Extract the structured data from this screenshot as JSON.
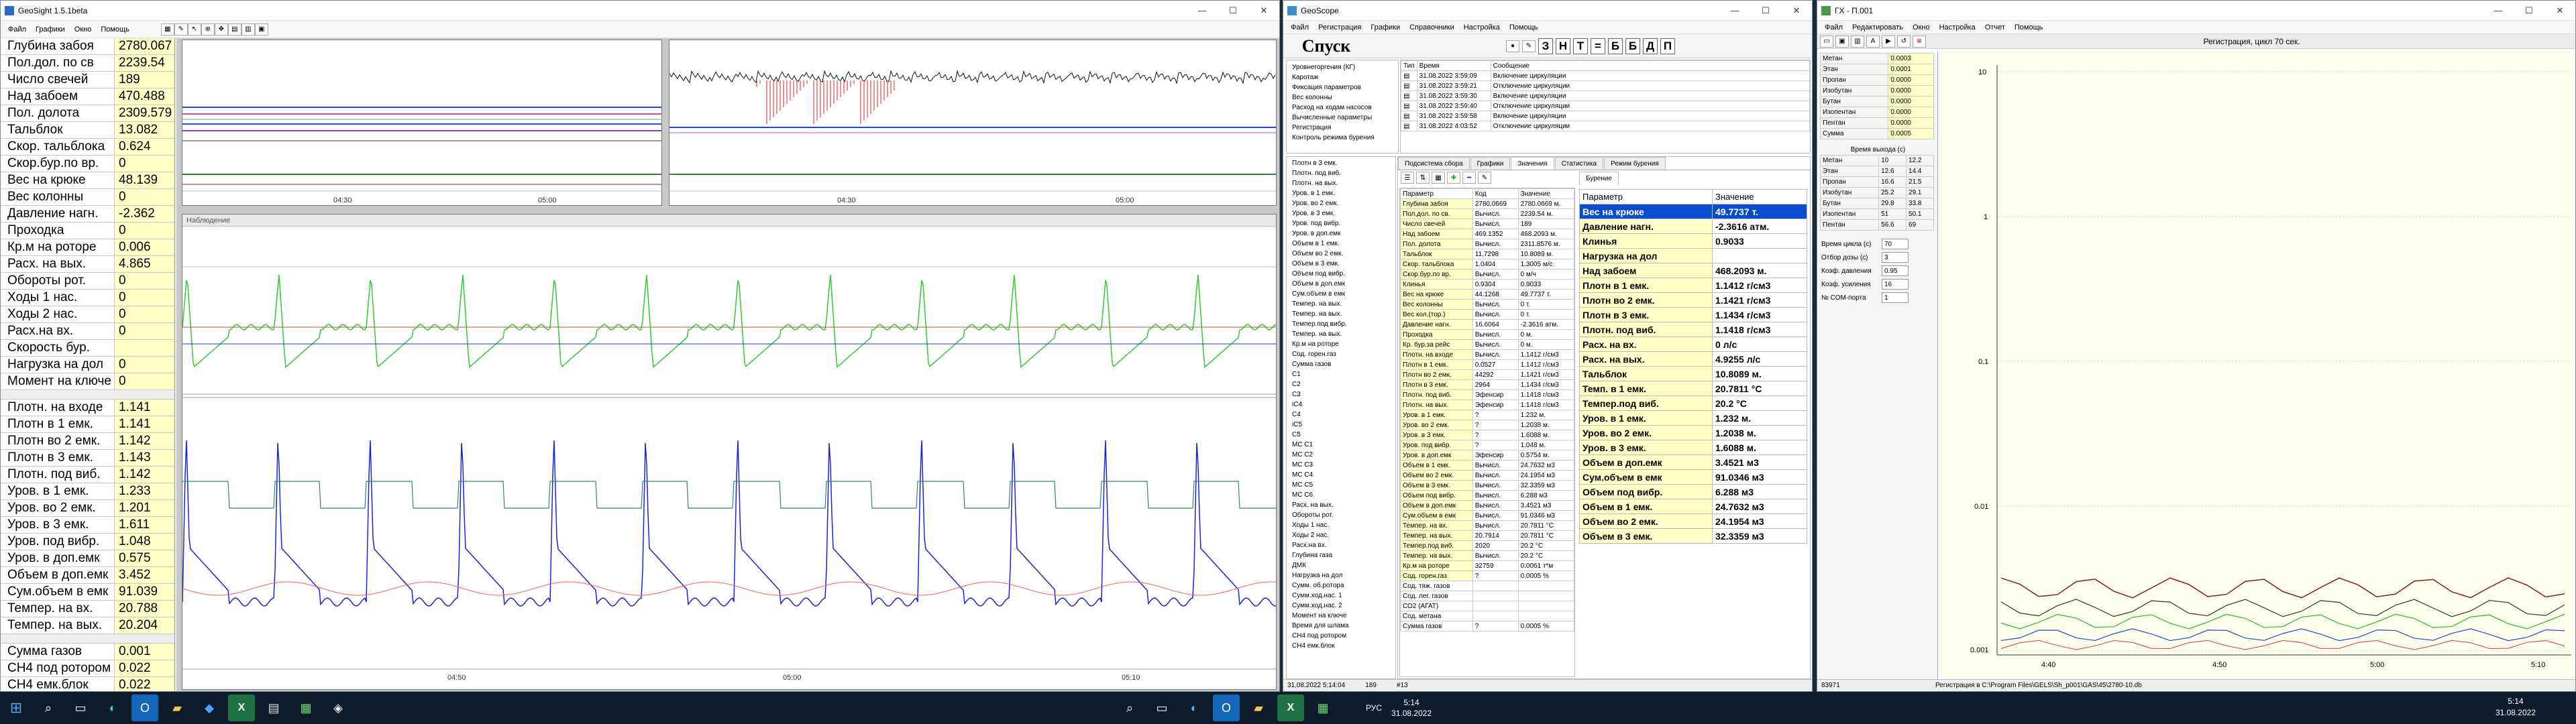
{
  "w1": {
    "title": "GeoSight 1.5.1beta",
    "menu": [
      "Файл",
      "Графики",
      "Окно",
      "Помощь"
    ],
    "params1": [
      {
        "n": "Глубина забоя",
        "v": "2780.067"
      },
      {
        "n": "Пол.дол. по св",
        "v": "2239.54"
      },
      {
        "n": "Число свечей",
        "v": "189"
      },
      {
        "n": "Над забоем",
        "v": "470.488"
      },
      {
        "n": "Пол. долота",
        "v": "2309.579"
      },
      {
        "n": "Тальблок",
        "v": "13.082"
      },
      {
        "n": "Скор. тальблока",
        "v": "0.624"
      },
      {
        "n": "Скор.бур.по вр.",
        "v": "0"
      },
      {
        "n": "Вес на крюке",
        "v": "48.139"
      },
      {
        "n": "Вес колонны",
        "v": "0"
      },
      {
        "n": "Давление нагн.",
        "v": "-2.362"
      },
      {
        "n": "Проходка",
        "v": "0"
      },
      {
        "n": "Кр.м на роторе",
        "v": "0.006"
      },
      {
        "n": "Расх. на вых.",
        "v": "4.865"
      },
      {
        "n": "Обороты рот.",
        "v": "0"
      },
      {
        "n": "Ходы 1 нас.",
        "v": "0"
      },
      {
        "n": "Ходы 2 нас.",
        "v": "0"
      },
      {
        "n": "Расх.на вх.",
        "v": "0"
      },
      {
        "n": "Скорость бур.",
        "v": ""
      },
      {
        "n": "Нагрузка на дол",
        "v": "0"
      },
      {
        "n": "Момент на ключе",
        "v": "0"
      }
    ],
    "params2": [
      {
        "n": "Плотн. на входе",
        "v": "1.141"
      },
      {
        "n": "Плотн в 1 емк.",
        "v": "1.141"
      },
      {
        "n": "Плотн во 2 емк.",
        "v": "1.142"
      },
      {
        "n": "Плотн в 3 емк.",
        "v": "1.143"
      },
      {
        "n": "Плотн. под виб.",
        "v": "1.142"
      },
      {
        "n": "Уров. в 1 емк.",
        "v": "1.233"
      },
      {
        "n": "Уров. во 2 емк.",
        "v": "1.201"
      },
      {
        "n": "Уров. в 3 емк.",
        "v": "1.611"
      },
      {
        "n": "Уров. под вибр.",
        "v": "1.048"
      },
      {
        "n": "Уров. в доп.емк",
        "v": "0.575"
      },
      {
        "n": "Объем в доп.емк",
        "v": "3.452"
      },
      {
        "n": "Сум.объем в емк",
        "v": "91.039"
      },
      {
        "n": "Темпер. на вх.",
        "v": "20.788"
      },
      {
        "n": "Темпер. на вых.",
        "v": "20.204"
      }
    ],
    "params3": [
      {
        "n": "Сумма газов",
        "v": "0.001"
      },
      {
        "n": "CH4 под ротором",
        "v": "0.022"
      },
      {
        "n": "CH4 емк.блок",
        "v": "0.022"
      }
    ],
    "chart1_ticks": [
      "04:30",
      "05:00"
    ],
    "chart2_ticks": [
      "04:30",
      "05:00"
    ],
    "chart3_title": "Наблюдение",
    "chart3_ticks": [
      "04:50",
      "05:00",
      "05:10"
    ]
  },
  "w2": {
    "title": "GeoScope",
    "menu": [
      "Файл",
      "Регистрация",
      "Графики",
      "Справочники",
      "Настройка",
      "Помощь"
    ],
    "mode": "Спуск",
    "letters": [
      "З",
      "Н",
      "Т",
      "=",
      "Б",
      "Б",
      "Д",
      "П"
    ],
    "left_list": [
      "Уровнегоргения (КГ)",
      "Каротаж",
      "Фиксация параметров",
      "Вес колонны",
      "Расход на ходам насосов",
      "Вычисленные параметры",
      "Регистрация",
      "Контроль режима бурения"
    ],
    "log_headers": [
      "Тип",
      "Время",
      "Сообщение"
    ],
    "log": [
      {
        "t": "31.08.2022 3:59:09",
        "m": "Включение циркуляции"
      },
      {
        "t": "31.08.2022 3:59:21",
        "m": "Отключение циркуляции"
      },
      {
        "t": "31.08.2022 3:59:30",
        "m": "Включение циркуляции"
      },
      {
        "t": "31.08.2022 3:59:40",
        "m": "Отключение циркуляции"
      },
      {
        "t": "31.08.2022 3:59:58",
        "m": "Включение циркуляции"
      },
      {
        "t": "31.08.2022 4:03:52",
        "m": "Отключение циркуляции"
      }
    ],
    "tabs": [
      "Подсистема сбора",
      "Графики",
      "Значения",
      "Статистика",
      "Режим бурения"
    ],
    "active_tab": "Значения",
    "tree": [
      "Плотн в 3 емк.",
      "Плотн. под виб.",
      "Плотн. на вых.",
      "Уров. в 1 емк.",
      "Уров. во 2 емк.",
      "Уров. в 3 емк.",
      "Уров. под вибр.",
      "Уров. в доп.емк",
      "Объем в 1 емк.",
      "Объем во 2 емк.",
      "Объем в 3 емк.",
      "Объем под вибр.",
      "Объем в доп.емк",
      "Сум.объем в емк",
      "Темпер. на вых.",
      "Темпер. на вых.",
      "Темпер.под вибр.",
      "Темпер. на вых.",
      "Кр.м на роторе",
      "Сод. горен.газ",
      "Сумма газов",
      "C1",
      "C2",
      "C3",
      "iC4",
      "C4",
      "iC5",
      "C5",
      "МС C1",
      "МС C2",
      "МС C3",
      "МС C4",
      "МС C5",
      "МС C6",
      "Расх. на вых.",
      "Обороты рот.",
      "Ходы 1 нас.",
      "Ходы 2 нас.",
      "Расх.на вх.",
      "Глубина газа",
      "ДМК",
      "Нагрузка на дол",
      "Сумм. об.ротора",
      "Сумм.ход.нас. 1",
      "Сумм.ход.нас. 2",
      "Момент на ключе",
      "Время для шлама",
      "CH4 под ротором",
      "CH4 емк.блок"
    ],
    "grid_headers": [
      "Параметр",
      "Код",
      "Значение"
    ],
    "grid": [
      [
        "Глубина забоя",
        "2780.0669",
        "2780.0669 м."
      ],
      [
        "Пол.дол. по св.",
        "Вычисл.",
        "2239.54 м."
      ],
      [
        "Число свечей",
        "Вычисл.",
        "189"
      ],
      [
        "Над забоем",
        "469.1352",
        "468.2093 м."
      ],
      [
        "Пол. долота",
        "Вычисл.",
        "2311.8576 м."
      ],
      [
        "Тальблок",
        "11.7298",
        "10.8089 м."
      ],
      [
        "Скор. тальблока",
        "1.0404",
        "1.3005 м/с"
      ],
      [
        "Скор.бур.по вр.",
        "Вычисл.",
        "0 м/ч"
      ],
      [
        "Клинья",
        "0.9304",
        "0.9033"
      ],
      [
        "Вес на крюке",
        "44.1268",
        "49.7737 т."
      ],
      [
        "Вес колонны",
        "Вычисл.",
        "0 т."
      ],
      [
        "Вес кол.(тор.)",
        "Вычисл.",
        "0 т."
      ],
      [
        "Давление нагн.",
        "16.6064",
        "-2.3616 атм."
      ],
      [
        "Проходка",
        "Вычисл.",
        "0 м."
      ],
      [
        "Кр. бур.за рейс",
        "Вычисл.",
        "0 м."
      ],
      [
        "Плотн. на входе",
        "Вычисл.",
        "1.1412 г/см3"
      ],
      [
        "Плотн в 1 емк.",
        "0.0527",
        "1.1412 г/см3"
      ],
      [
        "Плотн во 2 емк.",
        "44292",
        "1.1421 г/см3"
      ],
      [
        "Плотн в 3 емк.",
        "2964",
        "1.1434 г/см3"
      ],
      [
        "Плотн. под виб.",
        "Эфенсир",
        "1.1418 г/см3"
      ],
      [
        "Плотн. на вых.",
        "Эфенсир",
        "1.1418 г/см3"
      ],
      [
        "Уров. в 1 емк.",
        "?",
        "1.232 м."
      ],
      [
        "Уров. во 2 емк.",
        "?",
        "1.2038 м."
      ],
      [
        "Уров. в 3 емк.",
        "?",
        "1.6088 м."
      ],
      [
        "Уров. под вибр.",
        "?",
        "1.048 м."
      ],
      [
        "Уров. в доп.емк",
        "Эфенсир",
        "0.5754 м."
      ],
      [
        "Объем в 1 емк.",
        "Вычисл.",
        "24.7632 м3"
      ],
      [
        "Объем во 2 емк.",
        "Вычисл.",
        "24.1954 м3"
      ],
      [
        "Объем в 3 емк.",
        "Вычисл.",
        "32.3359 м3"
      ],
      [
        "Объем под вибр.",
        "Вычисл.",
        "6.288 м3"
      ],
      [
        "Объем в доп.емк",
        "Вычисл.",
        "3.4521 м3"
      ],
      [
        "Сум.объем в емк",
        "Вычисл.",
        "91.0346 м3"
      ],
      [
        "Темпер. на вх.",
        "Вычисл.",
        "20.7811 °C"
      ],
      [
        "Темпер. на вых.",
        "20.7914",
        "20.7811 °C"
      ],
      [
        "Темпер.под виб.",
        "2020",
        "20.2 °C"
      ],
      [
        "Темпер. на вых.",
        "Вычисл.",
        "20.2 °C"
      ],
      [
        "Кр.м на роторе",
        "32759",
        "0.0061 т*м"
      ],
      [
        "Сод. горен.газ",
        "?",
        "0.0005 %"
      ],
      [
        "Сод. тяж. газов",
        "",
        ""
      ],
      [
        "Сод. лег. газов",
        "",
        ""
      ],
      [
        "СО2 (АГАТ)",
        "",
        ""
      ],
      [
        "Сод. метана",
        "",
        ""
      ],
      [
        "Сумма газов",
        "?",
        "0.0005 %"
      ]
    ],
    "right_tab": "Бурение",
    "val_headers": [
      "Параметр",
      "Значение"
    ],
    "vals": [
      [
        "Вес на крюке",
        "49.7737 т."
      ],
      [
        "Давление нагн.",
        "-2.3616 атм."
      ],
      [
        "Клинья",
        "0.9033"
      ],
      [
        "Нагрузка на дол",
        ""
      ],
      [
        "Над забоем",
        "468.2093 м."
      ],
      [
        "Плотн в 1 емк.",
        "1.1412 г/см3"
      ],
      [
        "Плотн во 2 емк.",
        "1.1421 г/см3"
      ],
      [
        "Плотн в 3 емк.",
        "1.1434 г/см3"
      ],
      [
        "Плотн. под виб.",
        "1.1418 г/см3"
      ],
      [
        "Расх. на вх.",
        "0 л/с"
      ],
      [
        "Расх. на вых.",
        "4.9255 л/с"
      ],
      [
        "Тальблок",
        "10.8089 м."
      ],
      [
        "Темп. в 1 емк.",
        "20.7811 °C"
      ],
      [
        "Темпер.под виб.",
        "20.2 °C"
      ],
      [
        "Уров. в 1 емк.",
        "1.232 м."
      ],
      [
        "Уров. во 2 емк.",
        "1.2038 м."
      ],
      [
        "Уров. в 3 емк.",
        "1.6088 м."
      ],
      [
        "Объем в доп.емк",
        "3.4521 м3"
      ],
      [
        "Сум.объем в емк",
        "91.0346 м3"
      ],
      [
        "Объем под вибр.",
        "6.288 м3"
      ],
      [
        "Объем в 1 емк.",
        "24.7632 м3"
      ],
      [
        "Объем во 2 емк.",
        "24.1954 м3"
      ],
      [
        "Объем в 3 емк.",
        "32.3359 м3"
      ]
    ],
    "status_time": "31.08.2022 5:14:04",
    "status_n1": "189",
    "status_n2": "#13"
  },
  "w3": {
    "title": "ГХ - П.001",
    "menu": [
      "Файл",
      "Редактировать",
      "Окно",
      "Настройка",
      "Отчет",
      "Помощь"
    ],
    "cycle_label": "Регистрация, цикл 70 сек.",
    "comp": [
      [
        "Метан",
        "0.0003"
      ],
      [
        "Этан",
        "0.0001"
      ],
      [
        "Пропан",
        "0.0000"
      ],
      [
        "Изобутан",
        "0.0000"
      ],
      [
        "Бутан",
        "0.0000"
      ],
      [
        "Изопентан",
        "0.0000"
      ],
      [
        "Пентан",
        "0.0000"
      ],
      [
        "Сумма",
        "0.0005"
      ]
    ],
    "time_title": "Время выхода (с)",
    "times": [
      [
        "Метан",
        "10",
        "12.2"
      ],
      [
        "Этан",
        "12.6",
        "14.4"
      ],
      [
        "Пропан",
        "16.6",
        "21.5"
      ],
      [
        "Изобутан",
        "25.2",
        "29.1"
      ],
      [
        "Бутан",
        "29.8",
        "33.8"
      ],
      [
        "Изопентан",
        "51",
        "50.1"
      ],
      [
        "Пентан",
        "56.6",
        "69"
      ]
    ],
    "settings": [
      [
        "Время цикла (с)",
        "70"
      ],
      [
        "Отбор дозы (с)",
        "3"
      ],
      [
        "Коэф. давления",
        "0.95"
      ],
      [
        "Коэф. усиления",
        "16"
      ],
      [
        "№ COM-порта",
        "1"
      ]
    ],
    "yticks": [
      "10",
      "1",
      "0.1",
      "0.01",
      "0.001"
    ],
    "xticks": [
      "4:40",
      "4:50",
      "5:00",
      "5:10"
    ],
    "status_left": "83971",
    "status_path": "Регистрация в C:\\Program Files\\GELS\\Sh_p001\\GAS\\45\\2780-10.db"
  },
  "taskbar": {
    "lang": "РУС",
    "time": "5:14",
    "date": "31.08.2022"
  }
}
